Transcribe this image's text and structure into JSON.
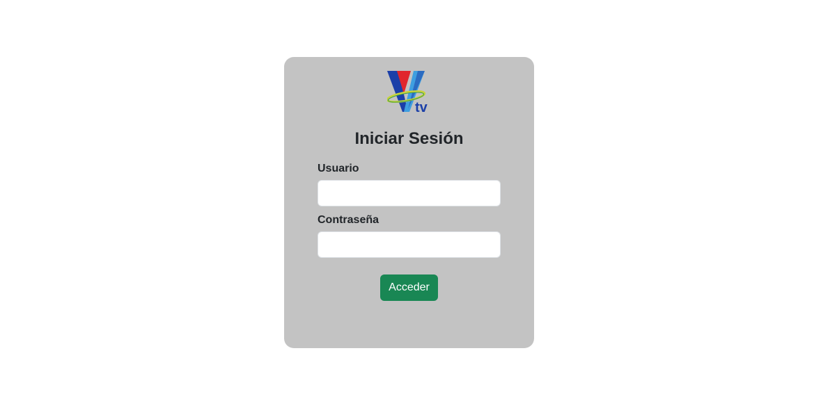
{
  "logo": {
    "text": "tv",
    "colors": {
      "blue": "#1b3fa8",
      "red": "#e1262c",
      "lightblue": "#3f9fe0",
      "ring": "#c8d33a",
      "ring_dark": "#3a9a4c"
    }
  },
  "login": {
    "title": "Iniciar Sesión",
    "user_label": "Usuario",
    "user_value": "",
    "pass_label": "Contraseña",
    "pass_value": "",
    "submit_label": "Acceder"
  },
  "colors": {
    "card_bg": "#c3c3c3",
    "button_bg": "#198754",
    "text": "#212529"
  }
}
